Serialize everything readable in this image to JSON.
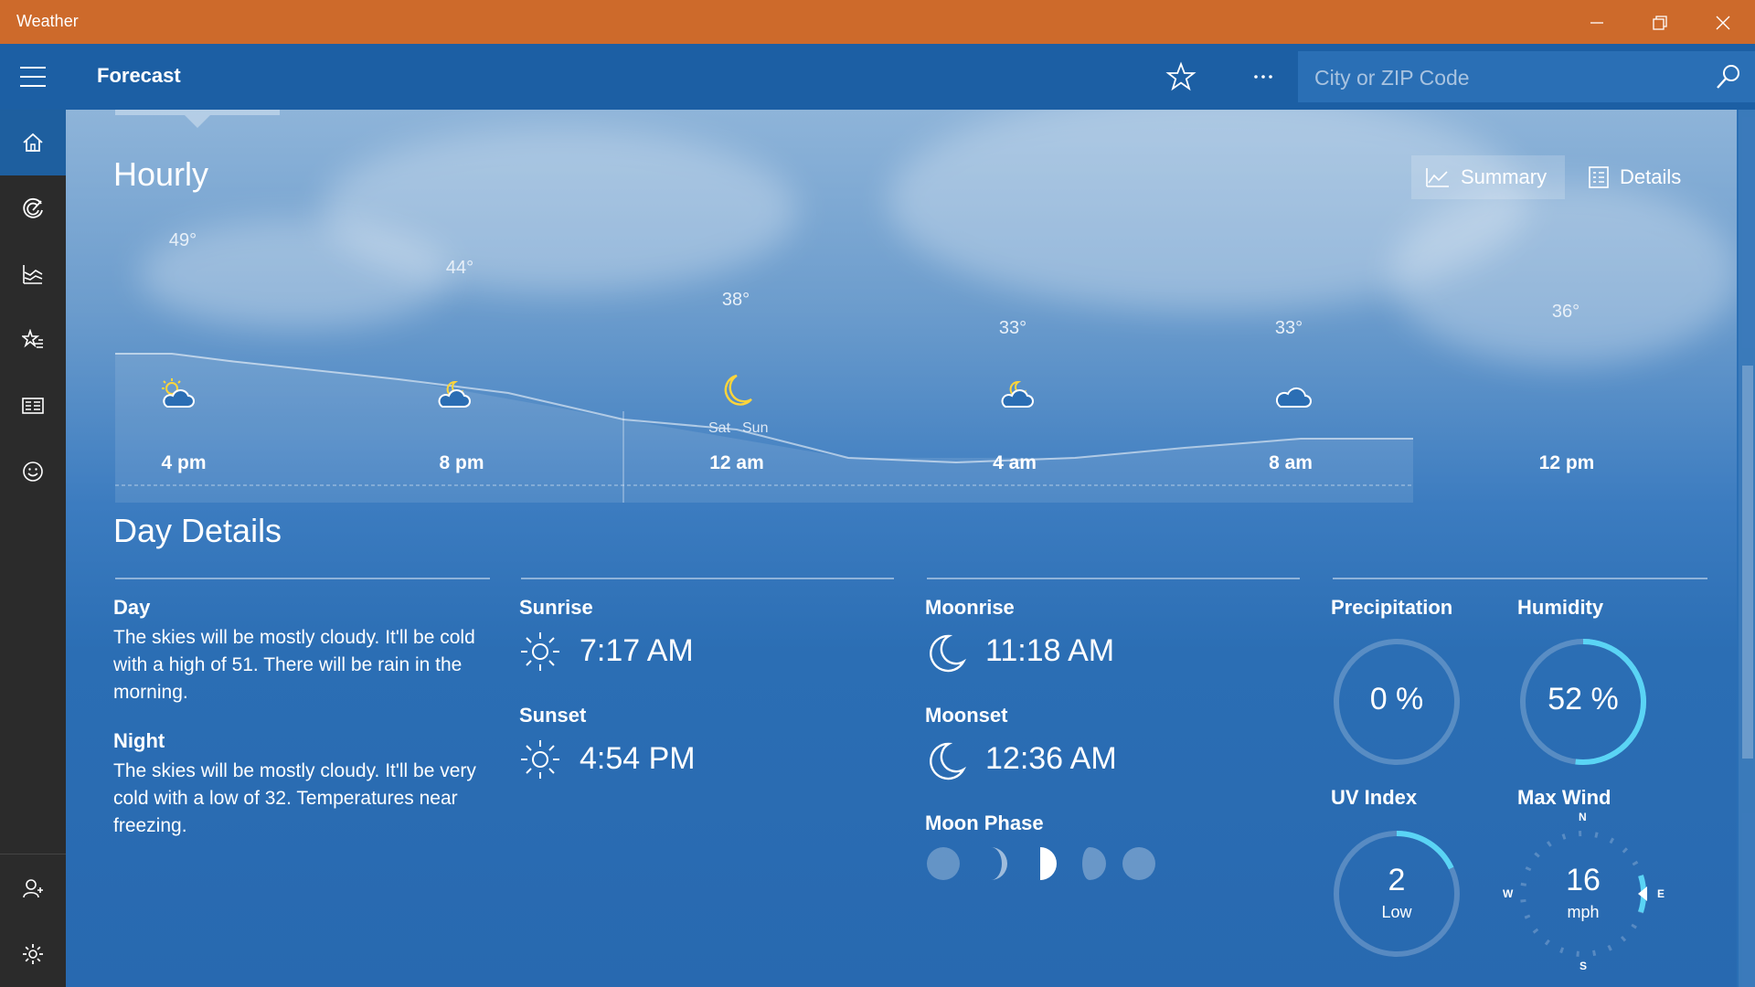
{
  "window": {
    "title": "Weather"
  },
  "appbar": {
    "title": "Forecast",
    "search_placeholder": "City or ZIP Code"
  },
  "sidebar": {
    "items": [
      {
        "name": "home",
        "active": true
      },
      {
        "name": "maps"
      },
      {
        "name": "historical-weather"
      },
      {
        "name": "places"
      },
      {
        "name": "news"
      },
      {
        "name": "feedback"
      }
    ],
    "bottom": [
      "account",
      "settings"
    ]
  },
  "hourly": {
    "title": "Hourly",
    "summary_label": "Summary",
    "details_label": "Details",
    "temperatures": [
      "49°",
      "44°",
      "38°",
      "33°",
      "33°",
      "36°"
    ],
    "times": [
      "4 pm",
      "8 pm",
      "12 am",
      "4 am",
      "8 am",
      "12 pm"
    ],
    "day_before": "Sat",
    "day_after": "Sun",
    "conditions": [
      "partly-sunny",
      "partly-cloudy-night",
      "clear-night",
      "partly-cloudy-night",
      "partly-cloudy-day",
      "cloudy"
    ]
  },
  "day_details": {
    "title": "Day Details",
    "day_label": "Day",
    "day_text": "The skies will be mostly cloudy. It'll be cold with a high of 51. There will be rain in the morning.",
    "night_label": "Night",
    "night_text": "The skies will be mostly cloudy. It'll be very cold with a low of 32. Temperatures near freezing.",
    "sunrise_label": "Sunrise",
    "sunrise": "7:17 AM",
    "sunset_label": "Sunset",
    "sunset": "4:54 PM",
    "moonrise_label": "Moonrise",
    "moonrise": "11:18 AM",
    "moonset_label": "Moonset",
    "moonset": "12:36 AM",
    "moon_phase_label": "Moon Phase",
    "precip_label": "Precipitation",
    "precip": "0 %",
    "precip_fraction": 0,
    "humidity_label": "Humidity",
    "humidity": "52 %",
    "humidity_fraction": 0.52,
    "uv_label": "UV Index",
    "uv": "2",
    "uv_desc": "Low",
    "uv_fraction": 0.18,
    "wind_label": "Max Wind",
    "wind": "16",
    "wind_unit": "mph",
    "compass": [
      "N",
      "E",
      "S",
      "W"
    ]
  },
  "colors": {
    "accent": "#5ad4f5",
    "titlebar": "#cd6a2b",
    "appbar": "#1c5fa4"
  }
}
